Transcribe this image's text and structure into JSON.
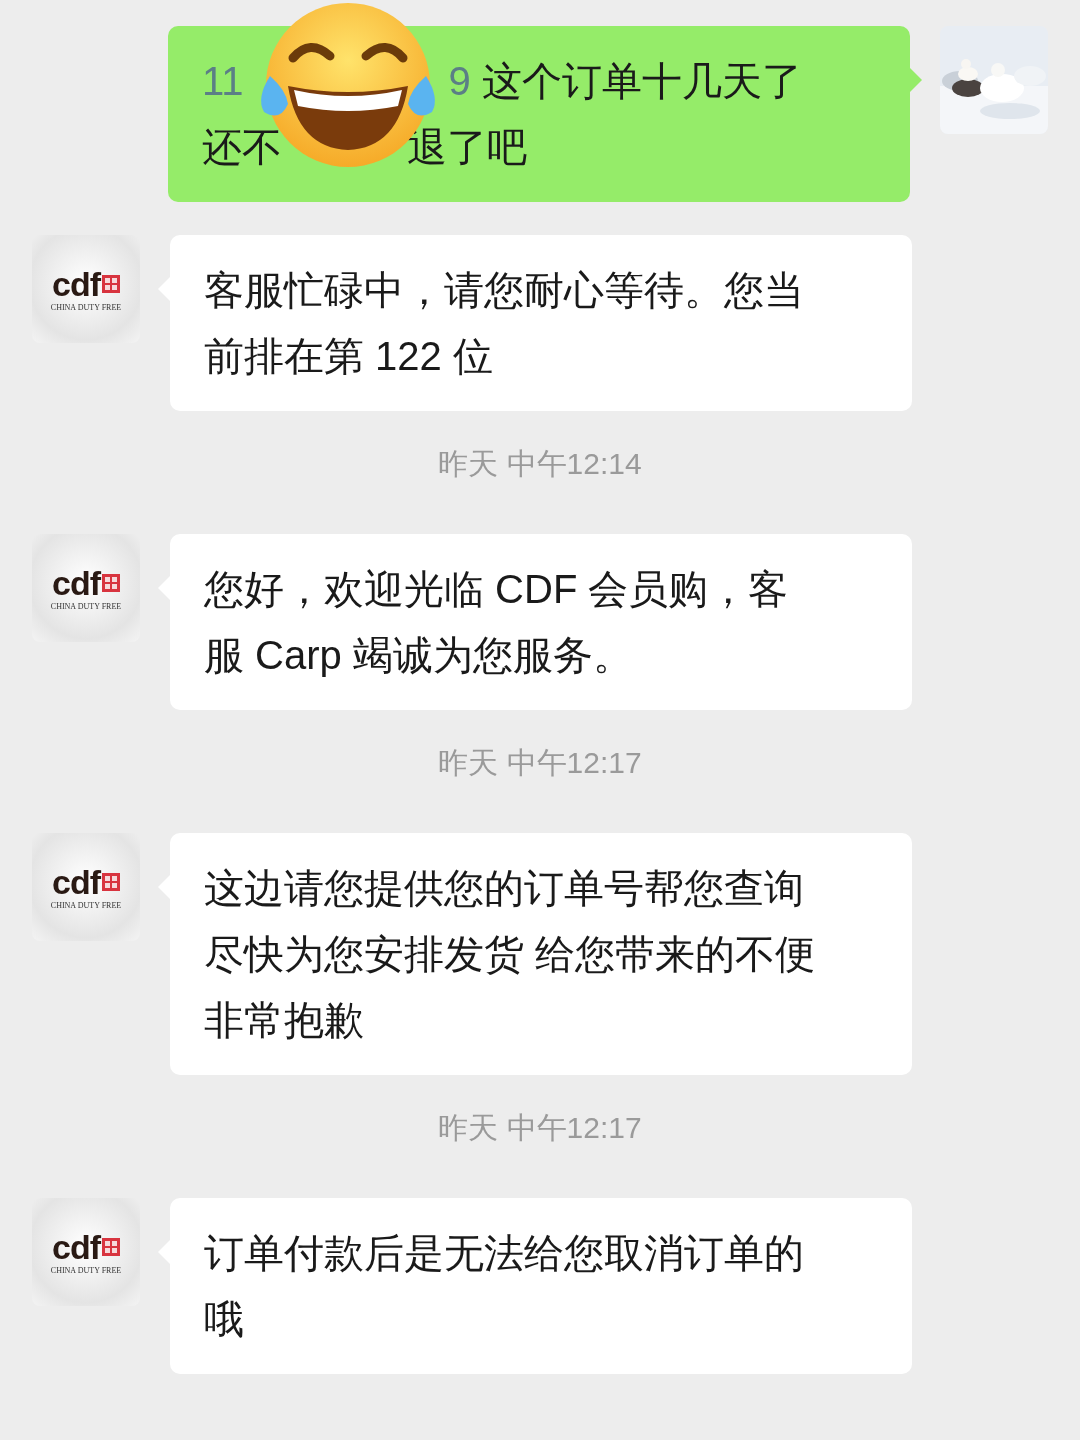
{
  "messages": [
    {
      "kind": "sent",
      "lines": [
        [
          {
            "kind": "number",
            "text": "11"
          },
          {
            "kind": "covered"
          },
          {
            "kind": "number",
            "text": "9"
          },
          {
            "kind": "text",
            "text": " 这个订单十几天了"
          }
        ],
        [
          {
            "kind": "text",
            "text": "还不"
          },
          {
            "kind": "covered"
          },
          {
            "kind": "text",
            "text": "退了吧"
          }
        ]
      ]
    },
    {
      "kind": "received",
      "lines": [
        "客服忙碌中，请您耐心等待。您当",
        "前排在第 122 位"
      ],
      "avatar": {
        "logo": "cdf",
        "caption": "CHINA DUTY FREE"
      }
    },
    {
      "kind": "time",
      "text": "昨天 中午12:14"
    },
    {
      "kind": "received",
      "lines": [
        "您好，欢迎光临 CDF 会员购，客",
        "服 Carp 竭诚为您服务。"
      ],
      "avatar": {
        "logo": "cdf",
        "caption": "CHINA DUTY FREE"
      }
    },
    {
      "kind": "time",
      "text": "昨天 中午12:17"
    },
    {
      "kind": "received",
      "lines": [
        "这边请您提供您的订单号帮您查询",
        "尽快为您安排发货 给您带来的不便",
        "非常抱歉"
      ],
      "avatar": {
        "logo": "cdf",
        "caption": "CHINA DUTY FREE"
      }
    },
    {
      "kind": "time",
      "text": "昨天 中午12:17"
    },
    {
      "kind": "received",
      "lines": [
        "订单付款后是无法给您取消订单的",
        "哦"
      ],
      "avatar": {
        "logo": "cdf",
        "caption": "CHINA DUTY FREE"
      }
    }
  ]
}
